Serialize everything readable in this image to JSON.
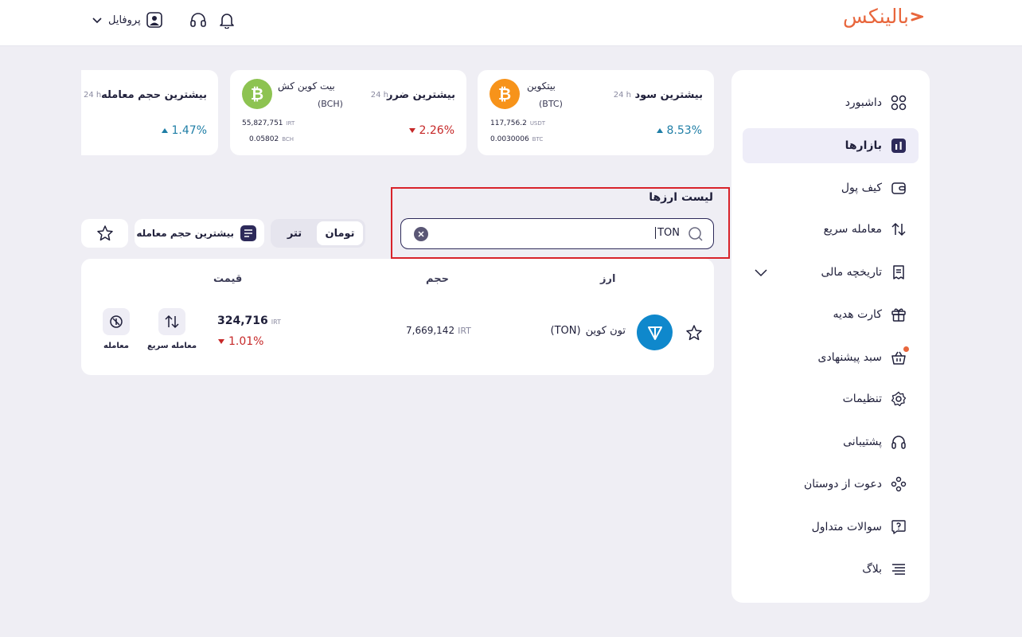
{
  "header": {
    "logo": "بالینکس",
    "profile_label": "پروفایل"
  },
  "sidebar": {
    "items": [
      {
        "label": "داشبورد"
      },
      {
        "label": "بازارها"
      },
      {
        "label": "کیف پول"
      },
      {
        "label": "معامله سریع"
      },
      {
        "label": "تاریخچه مالی"
      },
      {
        "label": "کارت هدیه"
      },
      {
        "label": "سبد پیشنهادی"
      },
      {
        "label": "تنظیمات"
      },
      {
        "label": "پشتیبانی"
      },
      {
        "label": "دعوت از دوستان"
      },
      {
        "label": "سوالات متداول"
      },
      {
        "label": "بلاگ"
      }
    ]
  },
  "stats": {
    "top_gain": {
      "title": "بیشترین سود",
      "period": "24 h",
      "coin_name": "بیتکوین",
      "coin_symbol": "(BTC)",
      "change": "8.53%",
      "price": "117,756.2",
      "price_unit": "USDT",
      "volume": "0.0030006",
      "volume_unit": "BTC"
    },
    "top_loss": {
      "title": "بیشترین ضرر",
      "period": "24 h",
      "coin_name": "بیت کوین کش",
      "coin_symbol": "(BCH)",
      "change": "2.26%",
      "price": "55,827,751",
      "price_unit": "IRT",
      "volume": "0.05802",
      "volume_unit": "BCH"
    },
    "top_volume": {
      "title": "بیشترین حجم معامله",
      "period": "24 h",
      "change": "1.47%"
    }
  },
  "list": {
    "title": "لیست ارزها",
    "search_value": "TON"
  },
  "filters": {
    "toman": "تومان",
    "tether": "تتر",
    "sort": "بیشترین حجم معامله"
  },
  "table": {
    "headers": {
      "coin": "ارز",
      "volume": "حجم",
      "price": "قیمت"
    },
    "rows": [
      {
        "name": "تون کوین",
        "symbol": "(TON)",
        "volume": "7,669,142",
        "volume_unit": "IRT",
        "price": "324,716",
        "price_unit": "IRT",
        "change": "1.01%",
        "action_quick": "معامله سریع",
        "action_trade": "معامله"
      }
    ]
  },
  "colors": {
    "brand": "#e8663c",
    "up": "#1f7ea6",
    "down": "#c62828",
    "dark": "#2d2a5a",
    "highlight": "#d8232a"
  }
}
